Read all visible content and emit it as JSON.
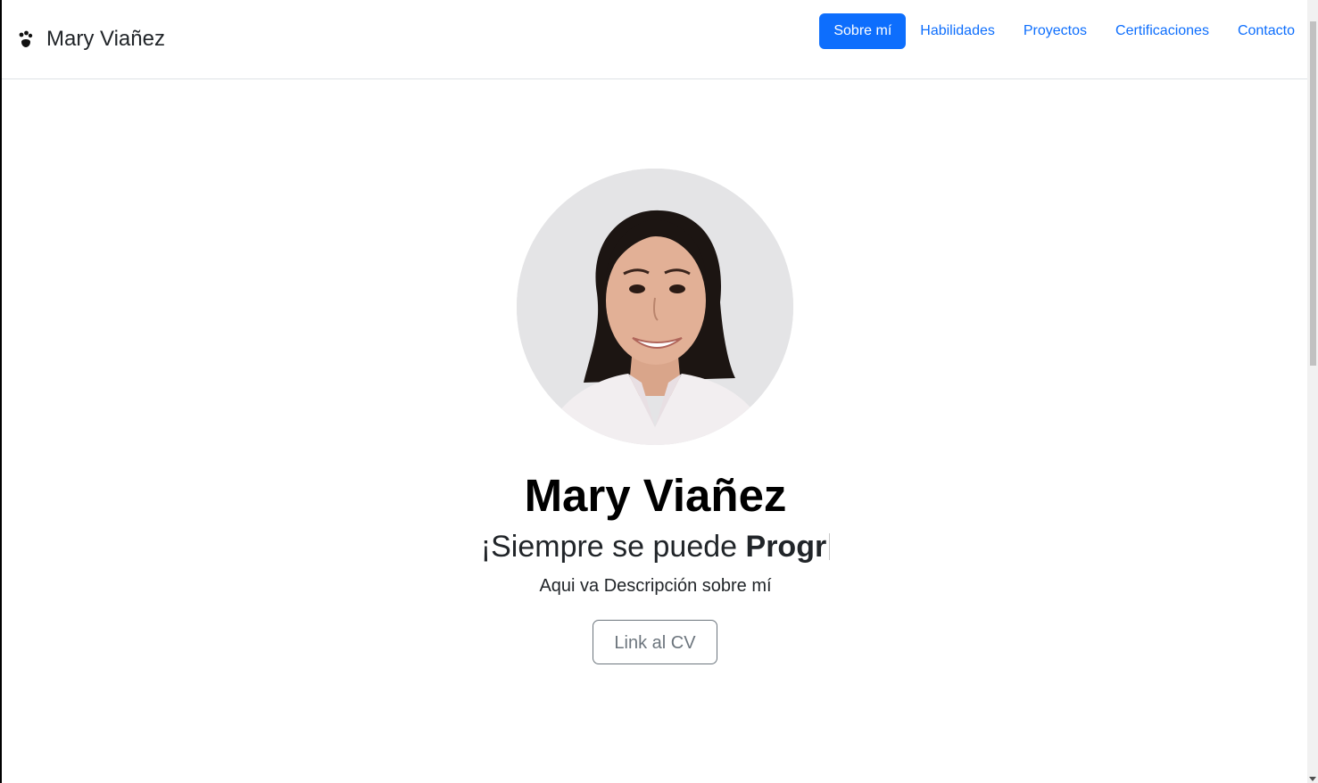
{
  "navbar": {
    "brand_icon": "paw-icon",
    "brand_name": "Mary Viañez",
    "links": [
      {
        "label": "Sobre mí",
        "active": true
      },
      {
        "label": "Habilidades",
        "active": false
      },
      {
        "label": "Proyectos",
        "active": false
      },
      {
        "label": "Certificaciones",
        "active": false
      },
      {
        "label": "Contacto",
        "active": false
      }
    ]
  },
  "hero": {
    "avatar_alt": "profile-photo",
    "name": "Mary Viañez",
    "tagline_static": "¡Siempre se puede ",
    "tagline_typed": "Progr",
    "description": "Aqui va Descripción sobre mí",
    "cv_button_label": "Link al CV"
  },
  "colors": {
    "primary": "#0d6efd",
    "secondary": "#6c757d",
    "text": "#212529"
  }
}
